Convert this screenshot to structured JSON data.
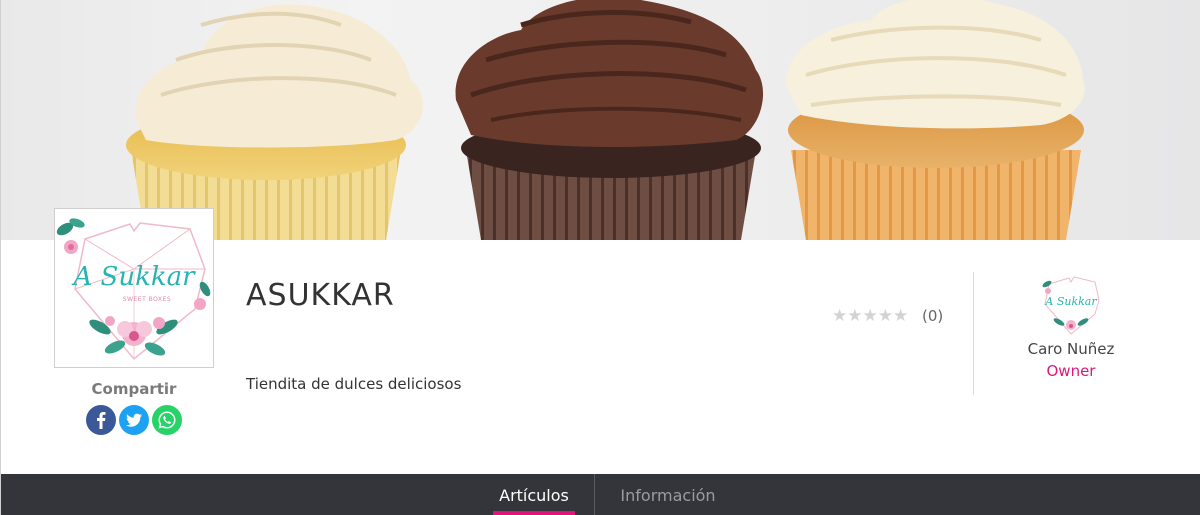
{
  "shop": {
    "name": "ASUKKAR",
    "description": "Tiendita de dulces deliciosos",
    "logo_script_text": "A Sukkar",
    "logo_tagline": "SWEET BOXES"
  },
  "share": {
    "label": "Compartir",
    "buttons": [
      "facebook-icon",
      "twitter-icon",
      "whatsapp-icon"
    ]
  },
  "rating": {
    "stars_text": "★★★★★",
    "count_text": "(0)",
    "value": 0,
    "max": 5
  },
  "owner": {
    "name": "Caro Nuñez",
    "role": "Owner"
  },
  "tabs": {
    "active_label": "Artículos",
    "info_label": "Información"
  },
  "colors": {
    "accent": "#e0157a",
    "tabbar": "#34343b",
    "logo_teal": "#29b3b3",
    "star_empty": "#d3d3d3"
  }
}
